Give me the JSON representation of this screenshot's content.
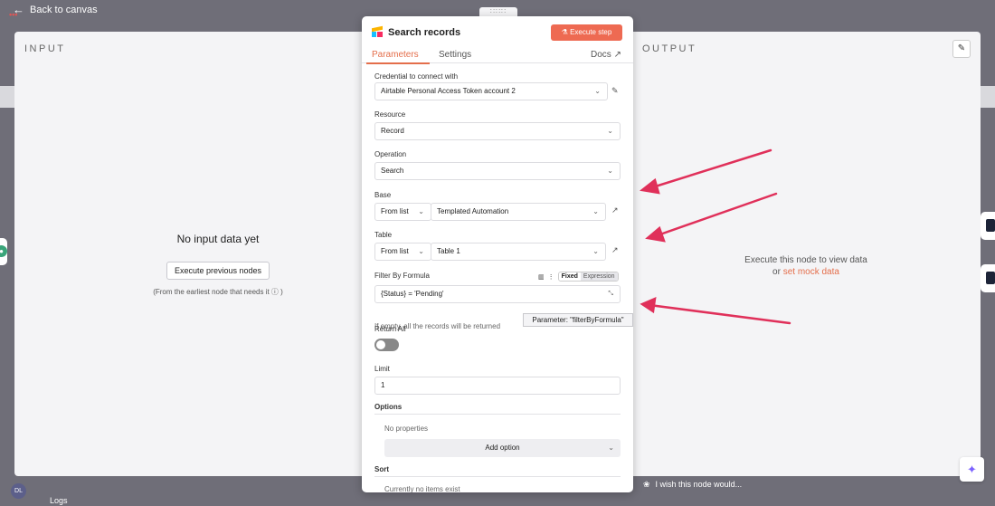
{
  "topbar": {
    "back_label": "Back to canvas"
  },
  "input_panel": {
    "title": "INPUT",
    "empty_message": "No input data yet",
    "execute_previous_label": "Execute previous nodes",
    "hint": "(From the earliest node that needs it ⓘ )"
  },
  "output_panel": {
    "title": "OUTPUT",
    "empty_line1": "Execute this node to view data",
    "empty_or": "or",
    "mock_link": "set mock data"
  },
  "modal": {
    "title": "Search records",
    "execute_step_label": "Execute step",
    "tabs": {
      "parameters": "Parameters",
      "settings": "Settings",
      "docs": "Docs"
    },
    "credential": {
      "label": "Credential to connect with",
      "value": "Airtable Personal Access Token account 2"
    },
    "resource": {
      "label": "Resource",
      "value": "Record"
    },
    "operation": {
      "label": "Operation",
      "value": "Search"
    },
    "base": {
      "label": "Base",
      "mode": "From list",
      "value": "Templated Automation"
    },
    "table": {
      "label": "Table",
      "mode": "From list",
      "value": "Table 1"
    },
    "filter": {
      "label": "Filter By Formula",
      "value": "{Status} = 'Pending'",
      "fixed": "Fixed",
      "expression": "Expression",
      "help": "If empty, all the records will be returned",
      "tooltip": "Parameter: \"filterByFormula\""
    },
    "return_all": {
      "label": "Return All"
    },
    "limit": {
      "label": "Limit",
      "value": "1"
    },
    "options": {
      "label": "Options",
      "empty": "No properties",
      "add_label": "Add option"
    },
    "sort": {
      "label": "Sort",
      "empty": "Currently no items exist"
    }
  },
  "bottom": {
    "avatar": "DL",
    "logs": "Logs",
    "wish": "I wish this node would..."
  },
  "colors": {
    "accent": "#e46e4b",
    "annotation_arrow": "#e0305a",
    "backdrop": "#6f6e78"
  }
}
